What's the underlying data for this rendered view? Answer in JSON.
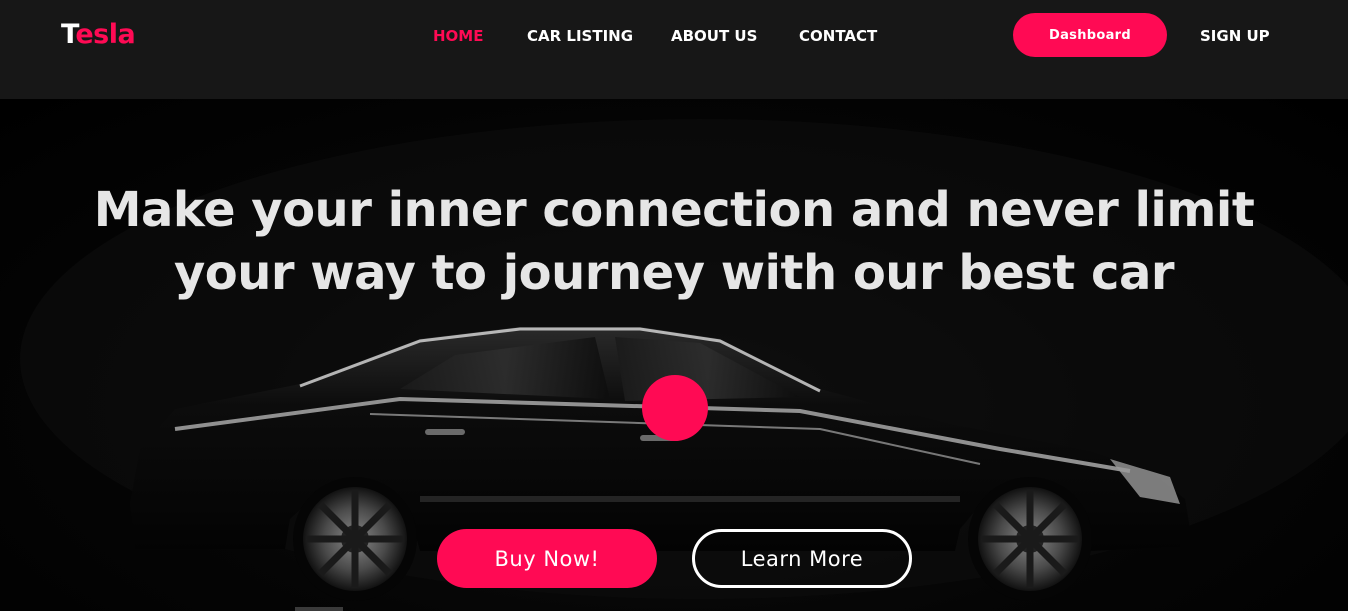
{
  "brand": {
    "first_letter": "T",
    "rest": "esla",
    "accent_color": "#ff0a54"
  },
  "nav": {
    "home": "HOME",
    "car_listing": "CAR LISTING",
    "about_us": "ABOUT US",
    "contact": "CONTACT",
    "active": "HOME"
  },
  "header_actions": {
    "dashboard": "Dashboard",
    "sign_up": "SIGN UP"
  },
  "hero": {
    "headline_line1": "Make your inner connection and never limit",
    "headline_line2": "your way to journey with our best car",
    "buy_now": "Buy Now!",
    "learn_more": "Learn More",
    "image": "black-sedan-car-image"
  },
  "colors": {
    "navbar_bg": "#171717",
    "hero_bg": "#000000",
    "accent": "#ff0a54",
    "headline": "#e6e6e6"
  }
}
